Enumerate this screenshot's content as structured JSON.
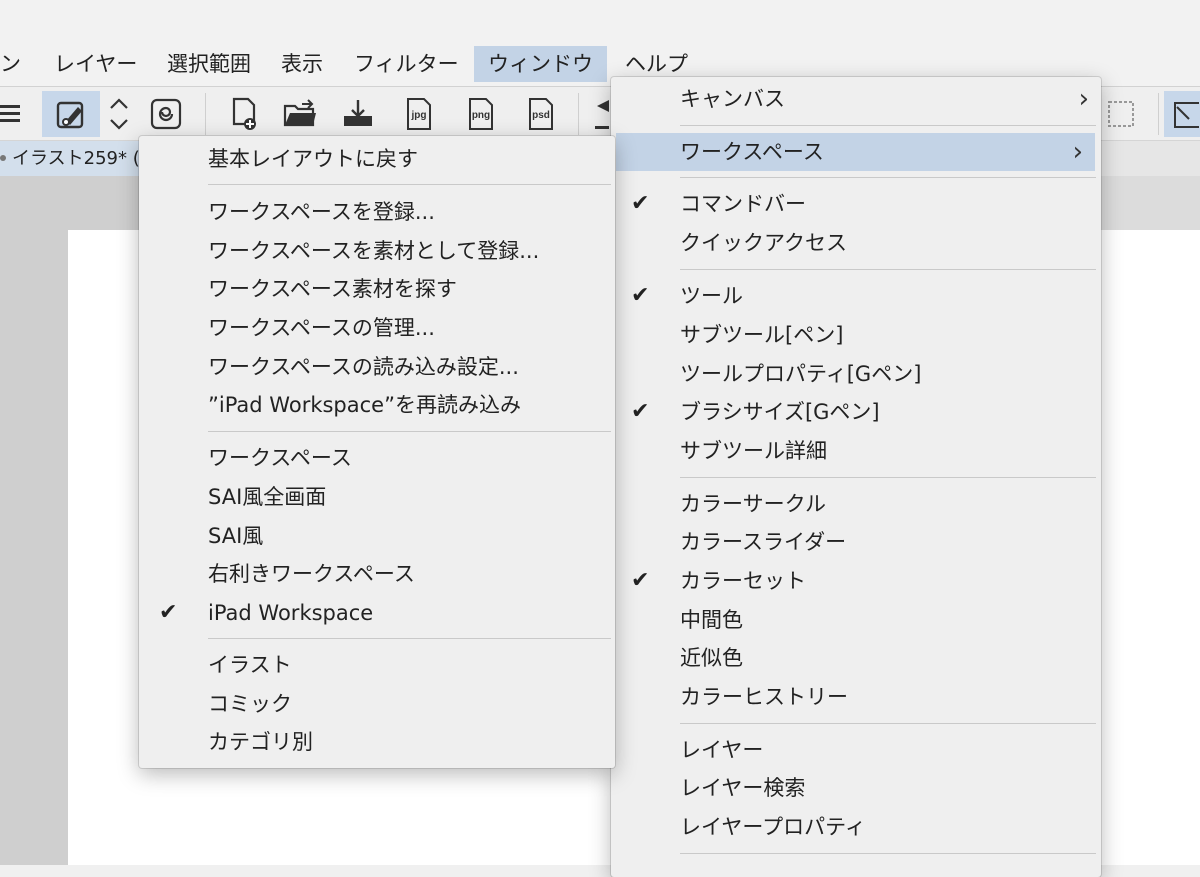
{
  "menubar": {
    "items": [
      {
        "label": "ン"
      },
      {
        "label": "レイヤー"
      },
      {
        "label": "選択範囲"
      },
      {
        "label": "表示"
      },
      {
        "label": "フィルター"
      },
      {
        "label": "ウィンドウ"
      },
      {
        "label": "ヘルプ"
      }
    ]
  },
  "toolbar": {
    "icons": [
      "menu-icon",
      "pen-icon",
      "up-down-arrows-icon",
      "spiral-icon",
      "new-file-icon",
      "open-folder-icon",
      "import-icon",
      "jpg-export-icon",
      "png-export-icon",
      "psd-export-icon"
    ],
    "jpg": "jpg",
    "png": "png",
    "psd": "psd"
  },
  "tab": {
    "title": "イラスト259* ("
  },
  "workspace_menu": {
    "items": [
      {
        "label": "基本レイアウトに戻す",
        "checked": false
      },
      {
        "label": "ワークスペースを登録...",
        "checked": false
      },
      {
        "label": "ワークスペースを素材として登録...",
        "checked": false
      },
      {
        "label": "ワークスペース素材を探す",
        "checked": false
      },
      {
        "label": "ワークスペースの管理...",
        "checked": false
      },
      {
        "label": "ワークスペースの読み込み設定...",
        "checked": false
      },
      {
        "label": "”iPad Workspace”を再読み込み",
        "checked": false
      },
      {
        "label": "ワークスペース",
        "checked": false
      },
      {
        "label": "SAI風全画面",
        "checked": false
      },
      {
        "label": "SAI風",
        "checked": false
      },
      {
        "label": "右利きワークスペース",
        "checked": false
      },
      {
        "label": "iPad Workspace",
        "checked": true
      },
      {
        "label": "イラスト",
        "checked": false
      },
      {
        "label": "コミック",
        "checked": false
      },
      {
        "label": "カテゴリ別",
        "checked": false
      }
    ]
  },
  "window_menu": {
    "items": [
      {
        "label": "キャンバス",
        "checked": false,
        "submenu": true
      },
      {
        "label": "ワークスペース",
        "checked": false,
        "submenu": true,
        "highlighted": true
      },
      {
        "label": "コマンドバー",
        "checked": true
      },
      {
        "label": "クイックアクセス",
        "checked": false
      },
      {
        "label": "ツール",
        "checked": true
      },
      {
        "label": "サブツール[ペン]",
        "checked": false
      },
      {
        "label": "ツールプロパティ[Gペン]",
        "checked": false
      },
      {
        "label": "ブラシサイズ[Gペン]",
        "checked": true
      },
      {
        "label": "サブツール詳細",
        "checked": false
      },
      {
        "label": "カラーサークル",
        "checked": false
      },
      {
        "label": "カラースライダー",
        "checked": false
      },
      {
        "label": "カラーセット",
        "checked": true
      },
      {
        "label": "中間色",
        "checked": false
      },
      {
        "label": "近似色",
        "checked": false
      },
      {
        "label": "カラーヒストリー",
        "checked": false
      },
      {
        "label": "レイヤー",
        "checked": false
      },
      {
        "label": "レイヤー検索",
        "checked": false
      },
      {
        "label": "レイヤープロパティ",
        "checked": false
      }
    ],
    "check_glyph": "✔",
    "arrow_glyph": "›"
  },
  "colors": {
    "highlight": "#c3d3e6",
    "menu_bg": "#efefef",
    "canvas": "#ffffff"
  }
}
